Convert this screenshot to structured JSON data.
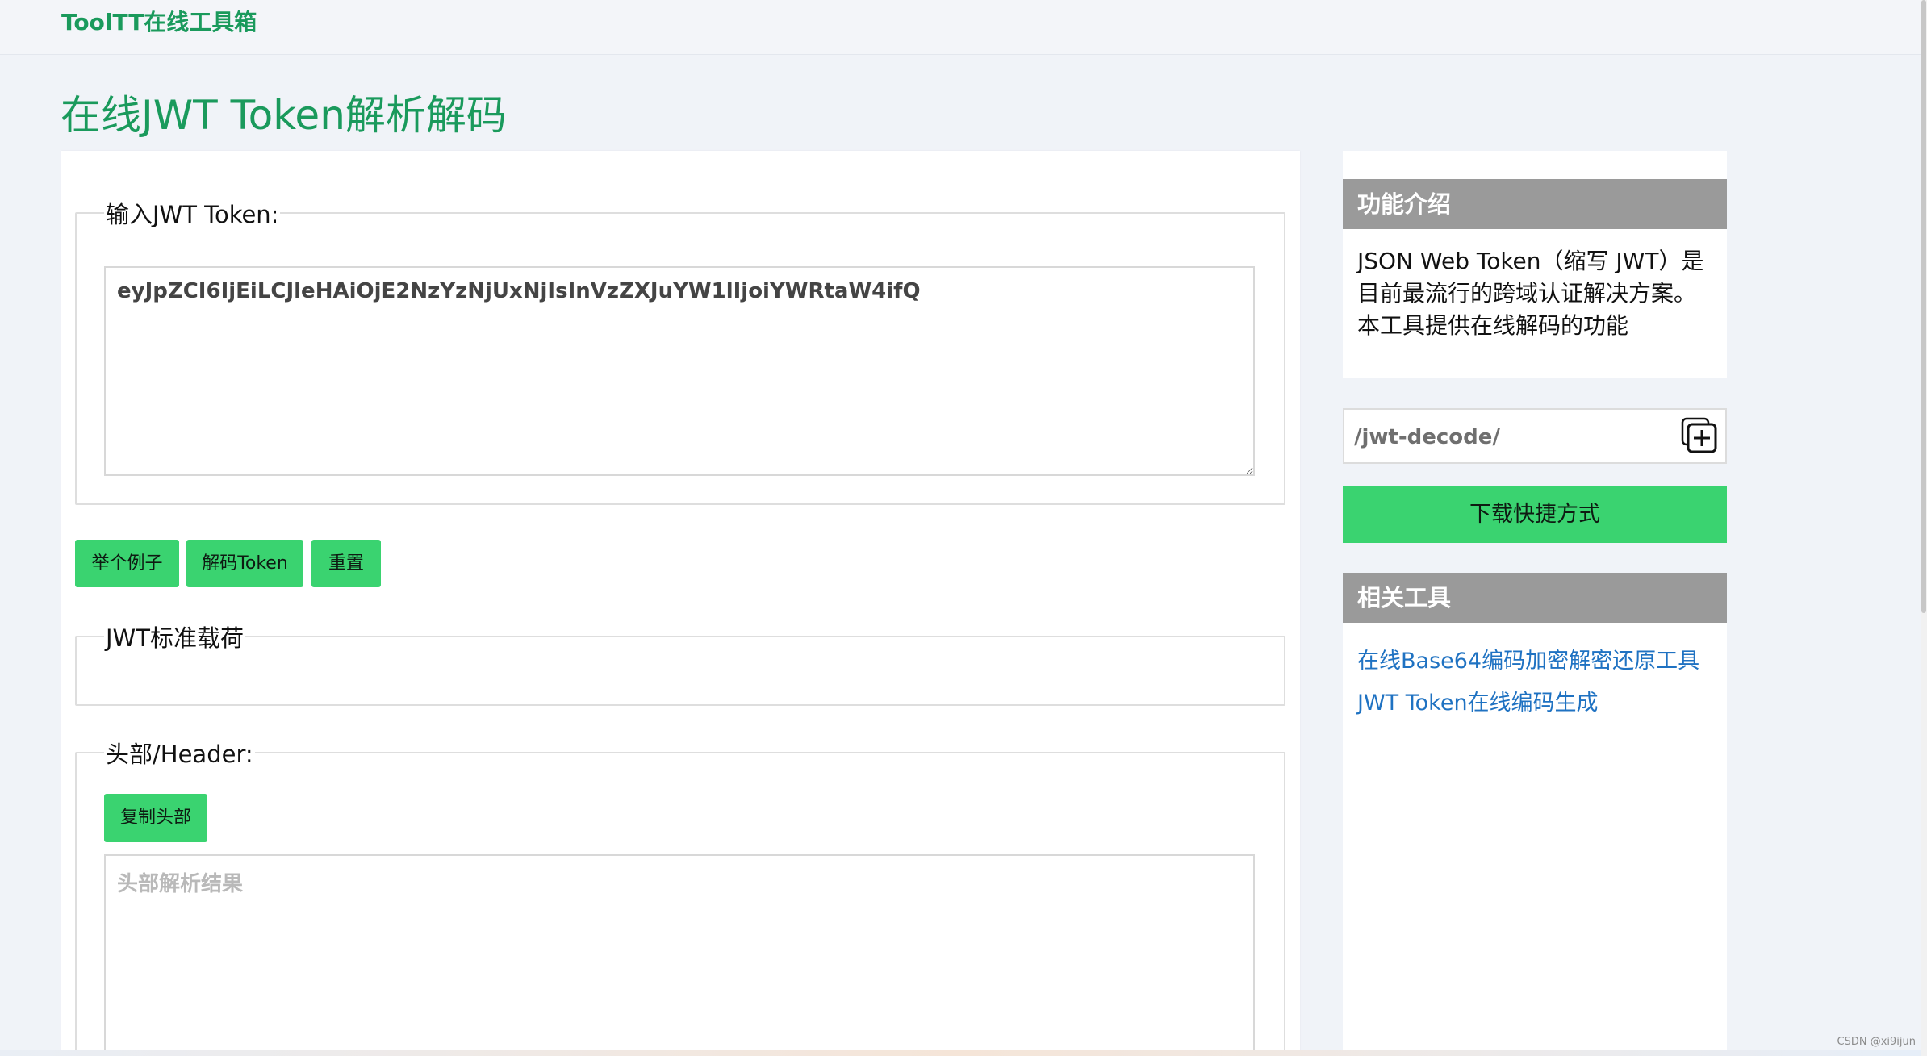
{
  "header": {
    "brand": "ToolTT在线工具箱"
  },
  "page": {
    "title": "在线JWT Token解析解码"
  },
  "token_section": {
    "legend": "输入JWT Token:",
    "value": "eyJpZCI6IjEiLCJleHAiOjE2NzYzNjUxNjIsInVzZXJuYW1lIjoiYWRtaW4ifQ"
  },
  "buttons": {
    "example": "举个例子",
    "decode": "解码Token",
    "reset": "重置"
  },
  "payload_section": {
    "legend": "JWT标准载荷"
  },
  "header_section": {
    "legend": "头部/Header:",
    "copy_button": "复制头部",
    "placeholder": "头部解析结果"
  },
  "sidebar": {
    "intro_title": "功能介绍",
    "intro_text": "JSON Web Token（缩写 JWT）是目前最流行的跨域认证解决方案。本工具提供在线解码的功能",
    "shortcut_path": "/jwt-decode/",
    "download_button": "下载快捷方式",
    "tools_title": "相关工具",
    "tools": [
      {
        "label": "在线Base64编码加密解密还原工具"
      },
      {
        "label": "JWT Token在线编码生成"
      }
    ]
  },
  "watermark": "CSDN @xi9ijun",
  "colors": {
    "accent": "#1a9a5c",
    "button": "#3ad370",
    "panel_head": "#9a9a9a",
    "link": "#1f72c2"
  }
}
